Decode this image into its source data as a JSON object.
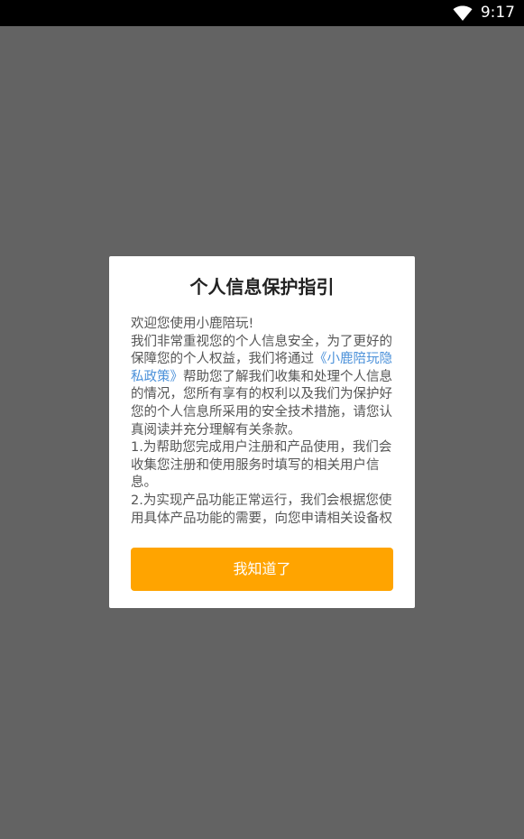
{
  "status_bar": {
    "time": "9:17",
    "wifi_icon": "wifi-icon"
  },
  "dialog": {
    "title": "个人信息保护指引",
    "body": {
      "welcome": "欢迎您使用小鹿陪玩!",
      "para1_before_link": "我们非常重视您的个人信息安全，为了更好的保障您的个人权益，我们将通过",
      "policy_link": "《小鹿陪玩隐私政策》",
      "para1_after_link": "帮助您了解我们收集和处理个人信息的情况，您所有享有的权利以及我们为保护好您的个人信息所采用的安全技术措施，请您认真阅读并充分理解有关条款。",
      "item1": "1.为帮助您完成用户注册和产品使用，我们会收集您注册和使用服务时填写的相关用户信息。",
      "item2": "2.为实现产品功能正常运行，我们会根据您使用具体产品功能的需要，向您申请相关设备权"
    },
    "confirm_label": "我知道了"
  },
  "colors": {
    "accent": "#ffa400",
    "link": "#4a90d9",
    "backdrop": "#636363"
  }
}
